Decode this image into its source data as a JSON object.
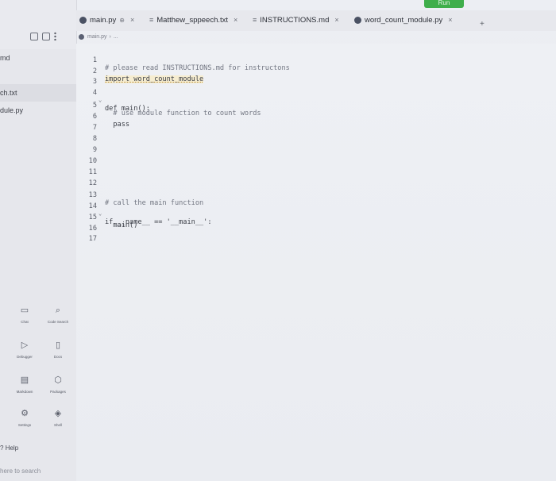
{
  "tabs": [
    {
      "label": "main.py",
      "badge": "⊕",
      "close": "×"
    },
    {
      "label": "Matthew_sppeech.txt",
      "close": "×"
    },
    {
      "label": "INSTRUCTIONS.md",
      "close": "×"
    },
    {
      "label": "word_count_module.py",
      "close": "×"
    }
  ],
  "run_label": "Run",
  "new_tab": "+",
  "breadcrumb": {
    "file": "main.py",
    "sep": "›",
    "more": "..."
  },
  "sidebar": {
    "files": [
      "md",
      "ch.txt",
      "dule.py"
    ],
    "tools": [
      {
        "label": "Chat",
        "icon": "chat-icon"
      },
      {
        "label": "Code Search",
        "icon": "search-icon"
      },
      {
        "label": "Debugger",
        "icon": "debugger-icon"
      },
      {
        "label": "Docs",
        "icon": "docs-icon"
      },
      {
        "label": "Markdown",
        "icon": "markdown-icon"
      },
      {
        "label": "Packages",
        "icon": "packages-icon"
      },
      {
        "label": "Settings",
        "icon": "gear-icon"
      },
      {
        "label": "Shell",
        "icon": "shell-icon"
      }
    ],
    "help": "Help",
    "search_hint": "here to search"
  },
  "editor": {
    "lines": [
      {
        "n": "1",
        "text": "# please read INSTRUCTIONS.md for instructons"
      },
      {
        "n": "2",
        "text": "import word_count_module"
      },
      {
        "n": "3",
        "text": ""
      },
      {
        "n": "4",
        "text": "def main():",
        "fold": true
      },
      {
        "n": "5",
        "text": "  # use module function to count words"
      },
      {
        "n": "6",
        "text": "  pass"
      },
      {
        "n": "7",
        "text": ""
      },
      {
        "n": "8",
        "text": ""
      },
      {
        "n": "9",
        "text": ""
      },
      {
        "n": "10",
        "text": ""
      },
      {
        "n": "11",
        "text": ""
      },
      {
        "n": "12",
        "text": ""
      },
      {
        "n": "13",
        "text": "# call the main function"
      },
      {
        "n": "14",
        "text": "if __name__ == '__main__':",
        "fold": true
      },
      {
        "n": "15",
        "text": "  main()"
      },
      {
        "n": "16",
        "text": ""
      },
      {
        "n": "17",
        "text": ""
      }
    ]
  }
}
